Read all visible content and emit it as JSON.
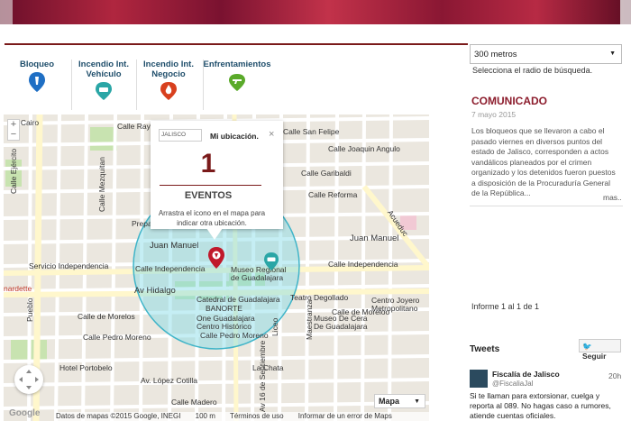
{
  "categories": [
    {
      "label": "Bloqueo",
      "icon": "blue-pin-icon",
      "color": "#1f6fc4"
    },
    {
      "label": "Incendio Int. Vehículo",
      "icon": "car-pin-icon",
      "color": "#2aa6a6"
    },
    {
      "label": "Incendio Int. Negocio",
      "icon": "fire-pin-icon",
      "color": "#d8401e"
    },
    {
      "label": "Enfrentamientos",
      "icon": "gun-pin-icon",
      "color": "#5aaa2a"
    }
  ],
  "radius": {
    "selected": "300 metros",
    "hint": "Selecciona el radio de búsqueda."
  },
  "popup": {
    "logo": "JALISCO",
    "title": "Mi ubicación.",
    "close": "×",
    "count": "1",
    "count_label": "EVENTOS",
    "instructions": "Arrastra el icono en el mapa para indicar otra ubicación."
  },
  "map": {
    "zoom_in": "+",
    "zoom_out": "−",
    "streets": {
      "rayo": "Calle Ray",
      "cairo": "e Y Cairo",
      "mezquitan": "Calle Mezquitan",
      "ejercito": "Calle Ejército",
      "sanfelipe": "Calle San Felipe",
      "joaquin": "Calle Joaquin Angulo",
      "garibaldi": "Calle Garibaldi",
      "reforma": "Calle Reforma",
      "acueducto": "Acueduc",
      "juanmanuel1": "Juan Manuel",
      "juanmanuel2": "Juan Manuel",
      "servicio": "Servicio Independencia",
      "independencia1": "Calle Independencia",
      "independencia2": "Calle Independencia",
      "hidalgo": "Av Hidalgo",
      "museo": "Museo Regional de Guadalajara",
      "catedral": "Catedral de Guadalajara",
      "degollado": "Teatro Degollado",
      "centro_joyero": "Centro Joyero Metropolitano",
      "banorte": "BANORTE",
      "morelos": "Calle de Morelos",
      "morelos2": "Calle de Moreloo",
      "one_gdl": "One Guadalajara Centro Histórico",
      "pedro1": "Calle Pedro Moreno",
      "pedro2": "Calle Pedro Moreno",
      "cera": "Museo De Cera De Guadalajara",
      "portobelo": "Hotel Portobelo",
      "lopez": "Av. López Cotilla",
      "chata": "La Chata",
      "madero": "Calle Madero",
      "liceo": "Liceo",
      "maestranza": "Maestranza",
      "dic": "Av 16 de Septiembre",
      "prepa": "Prepa",
      "pueblo": "Pueblo",
      "nardette": "nardette"
    },
    "type": "Mapa",
    "google": "Google",
    "attrib_data": "Datos de mapas ©2015 Google, INEGI",
    "attrib_scale": "100 m",
    "attrib_terms": "Términos de uso",
    "attrib_report": "Informar de un error de Maps"
  },
  "communique": {
    "title": "COMUNICADO",
    "date": "7 mayo 2015",
    "text": "Los bloqueos que se llevaron a cabo el pasado viernes en diversos puntos del estado de Jalisco, corresponden a actos vandálicos planeados por el crimen organizado y los detenidos fueron puestos a disposición de la Procuraduría General de la República...",
    "more": "mas.."
  },
  "pagination": "Informe 1 al 1 de 1",
  "tweets": {
    "title": "Tweets",
    "follow": "Seguir",
    "author": "Fiscalía de Jalisco",
    "handle": "@FiscaliaJal",
    "time": "20h",
    "text": "Si te llaman para extorsionar, cuelga y reporta al 089. No hagas caso a rumores, atiende cuentas oficiales."
  }
}
